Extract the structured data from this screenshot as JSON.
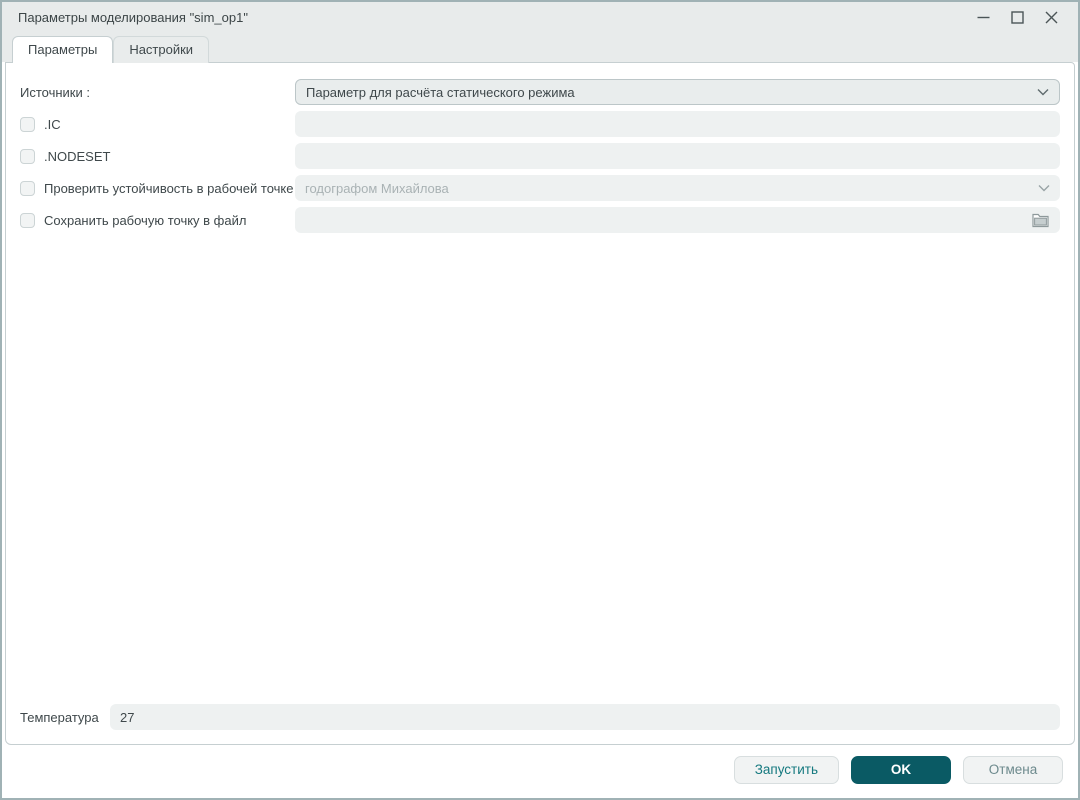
{
  "window": {
    "title": "Параметры моделирования \"sim_op1\""
  },
  "tabs": [
    {
      "label": "Параметры",
      "active": true
    },
    {
      "label": "Настройки",
      "active": false
    }
  ],
  "form": {
    "sources": {
      "label": "Источники :",
      "value": "Параметр для расчёта статического режима"
    },
    "ic": {
      "label": ".IC",
      "value": "",
      "checked": false
    },
    "nodeset": {
      "label": ".NODESET",
      "value": "",
      "checked": false
    },
    "stability": {
      "label": "Проверить устойчивость в рабочей точке",
      "value": "годографом Михайлова",
      "checked": false,
      "disabled": true
    },
    "save_point": {
      "label": "Сохранить рабочую точку в файл",
      "value": "",
      "checked": false
    },
    "temperature": {
      "label": "Температура",
      "value": "27"
    }
  },
  "footer": {
    "run_label": "Запустить",
    "ok_label": "OK",
    "cancel_label": "Отмена"
  },
  "icons": {
    "dropdown_chevron": "chevron-down",
    "file_browse": "folder"
  },
  "colors": {
    "accent_teal": "#0a5a64",
    "titlebar_bg": "#e8ebeb",
    "field_bg": "#eef1f1",
    "bordered_field_bg": "#e9eded",
    "text": "#3f484b",
    "disabled_text": "#a9b2b4"
  }
}
